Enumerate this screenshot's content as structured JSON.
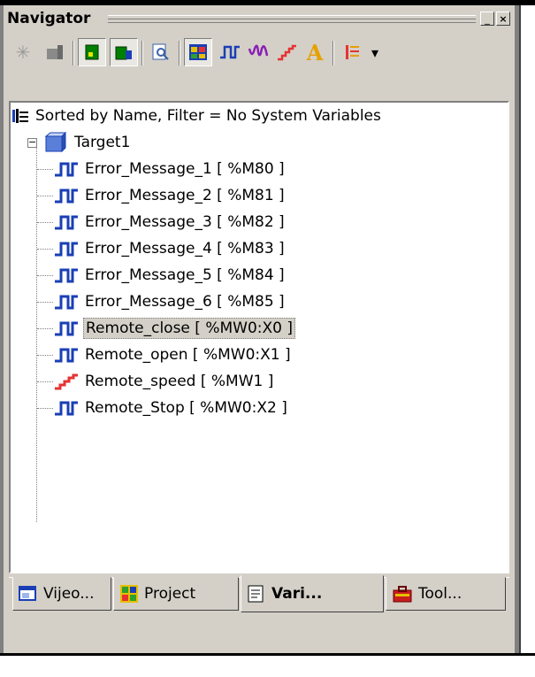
{
  "window": {
    "title": "Navigator",
    "minimize_label": "_",
    "close_label": "×"
  },
  "toolbar": {
    "buttons": [
      {
        "name": "asterisk-icon",
        "glyph": "✳"
      },
      {
        "name": "device-icon",
        "glyph": "▆"
      },
      {
        "name": "green-module-icon"
      },
      {
        "name": "green-modules-icon"
      },
      {
        "name": "zoom-page-icon"
      },
      {
        "name": "grid-view-icon"
      },
      {
        "name": "bool-signal-icon"
      },
      {
        "name": "analog-signal-icon"
      },
      {
        "name": "ramp-signal-icon"
      },
      {
        "name": "text-variable-icon",
        "glyph": "A"
      },
      {
        "name": "column-list-icon"
      },
      {
        "name": "dropdown-arrow-icon",
        "glyph": "▾"
      }
    ]
  },
  "tree": {
    "filter_text": "Sorted by Name, Filter = No System Variables",
    "root_label": "Target1",
    "expander": "−",
    "items": [
      {
        "label": "Error_Message_1  [ %M80 ]",
        "icon": "bool"
      },
      {
        "label": "Error_Message_2  [ %M81 ]",
        "icon": "bool"
      },
      {
        "label": "Error_Message_3  [ %M82 ]",
        "icon": "bool"
      },
      {
        "label": "Error_Message_4  [ %M83 ]",
        "icon": "bool"
      },
      {
        "label": "Error_Message_5  [ %M84 ]",
        "icon": "bool"
      },
      {
        "label": "Error_Message_6  [ %M85 ]",
        "icon": "bool"
      },
      {
        "label": "Remote_close  [ %MW0:X0 ]",
        "icon": "bool",
        "selected": true
      },
      {
        "label": "Remote_open  [ %MW0:X1 ]",
        "icon": "bool"
      },
      {
        "label": "Remote_speed  [ %MW1 ]",
        "icon": "analog"
      },
      {
        "label": "Remote_Stop  [ %MW0:X2 ]",
        "icon": "bool"
      }
    ]
  },
  "tabs": [
    {
      "label": "Vijeo...",
      "icon": "window-icon"
    },
    {
      "label": "Project",
      "icon": "project-icon"
    },
    {
      "label": "Vari...",
      "icon": "variables-icon",
      "active": true
    },
    {
      "label": "Tool...",
      "icon": "toolbox-icon"
    }
  ]
}
